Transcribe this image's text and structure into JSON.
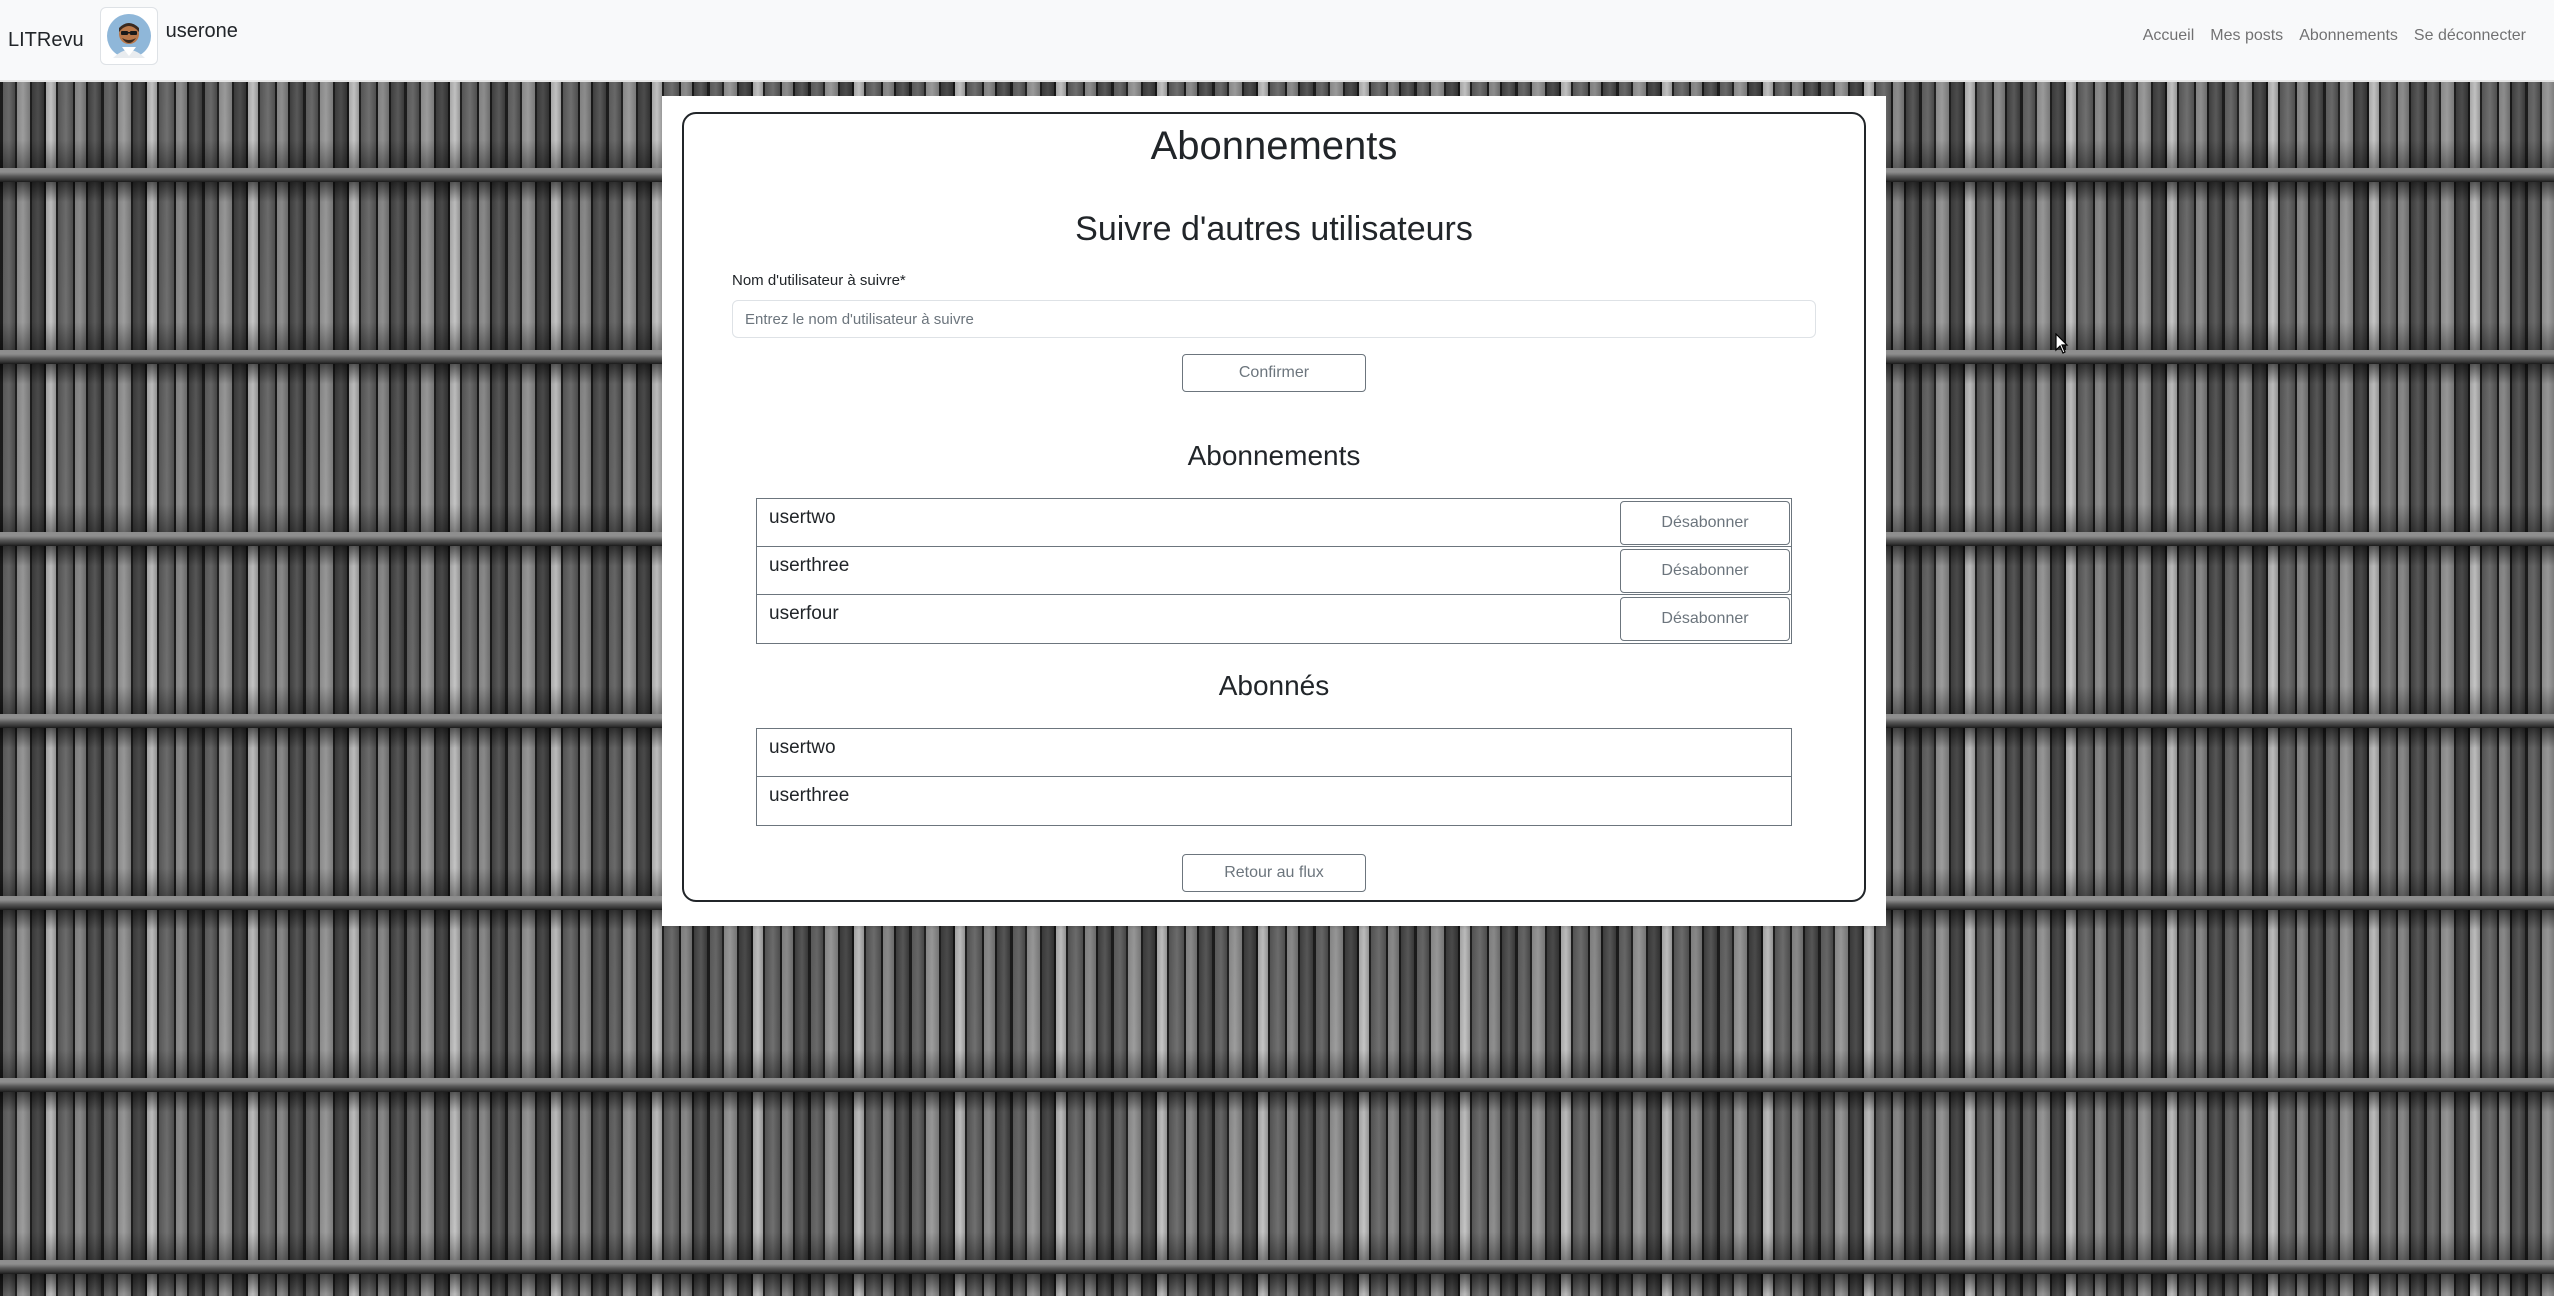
{
  "navbar": {
    "brand": "LITRevu",
    "username": "userone",
    "links": [
      "Accueil",
      "Mes posts",
      "Abonnements",
      "Se déconnecter"
    ]
  },
  "page": {
    "title": "Abonnements",
    "follow_section_title": "Suivre d'autres utilisateurs",
    "follow_label": "Nom d'utilisateur à suivre*",
    "follow_placeholder": "Entrez le nom d'utilisateur à suivre",
    "confirm_label": "Confirmer",
    "subscriptions_title": "Abonnements",
    "unsubscribe_label": "Désabonner",
    "subscriptions": [
      "usertwo",
      "userthree",
      "userfour"
    ],
    "followers_title": "Abonnés",
    "followers": [
      "usertwo",
      "userthree"
    ],
    "back_label": "Retour au flux"
  },
  "colors": {
    "navbar_bg": "#f8f9fa",
    "card_border": "#212529",
    "outline_button": "#6c757d"
  },
  "icons": {
    "avatar": "user-avatar-icon",
    "cursor": "mouse-pointer-icon"
  }
}
